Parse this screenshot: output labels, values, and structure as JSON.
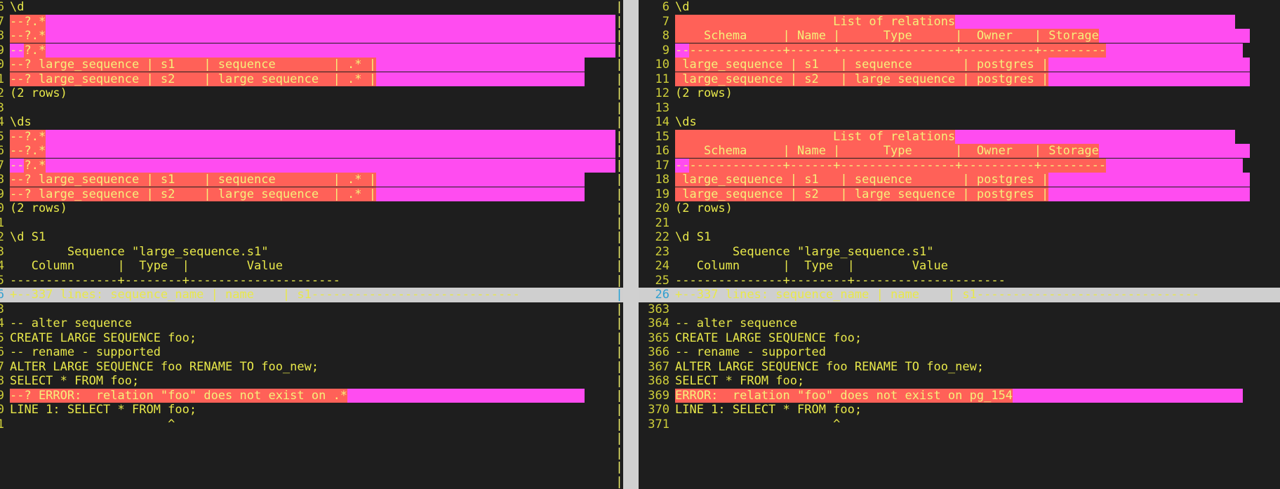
{
  "app": {
    "kind": "vimdiff-terminal",
    "colors": {
      "background": "#1e1e1e",
      "foreground": "#e8e84a",
      "line_number": "#cfcf3a",
      "diff_change_bg": "#ff6158",
      "diff_text_bg": "#ff4cf0",
      "fold_bg": "#cfcfcf",
      "fold_fg": "#1c9fd4",
      "scrollbar_bg": "#d0d0d0",
      "separator_fg": "#f2f26a"
    }
  },
  "separator": {
    "glyph": "|",
    "fold_glyph": "|"
  },
  "left_pane": {
    "name": "expected-output",
    "lines": [
      {
        "num": "6",
        "style": "plain",
        "segments": [
          {
            "cls": "plain",
            "text": "\\d"
          }
        ]
      },
      {
        "num": "7",
        "style": "diff",
        "segments": [
          {
            "cls": "dchange",
            "text": "--?.*"
          },
          {
            "cls": "dtext",
            "text": "                                                                                "
          }
        ]
      },
      {
        "num": "8",
        "style": "diff",
        "segments": [
          {
            "cls": "dchange",
            "text": "--?.*"
          },
          {
            "cls": "dtext",
            "text": "                                                                                "
          }
        ]
      },
      {
        "num": "9",
        "style": "diff",
        "segments": [
          {
            "cls": "dtext",
            "text": "--"
          },
          {
            "cls": "dchange",
            "text": "?.*"
          },
          {
            "cls": "dtext",
            "text": "                                                                                "
          }
        ]
      },
      {
        "num": "0",
        "style": "diff",
        "segments": [
          {
            "cls": "dchange",
            "text": "--? large_sequence | s1    | sequence        | .* |"
          },
          {
            "cls": "dtext",
            "text": "                             "
          }
        ]
      },
      {
        "num": "1",
        "style": "diff",
        "segments": [
          {
            "cls": "dchange",
            "text": "--? large_sequence | s2    | large sequence  | .* |"
          },
          {
            "cls": "dtext",
            "text": "                             "
          }
        ]
      },
      {
        "num": "2",
        "style": "plain",
        "segments": [
          {
            "cls": "plain",
            "text": "(2 rows)"
          }
        ]
      },
      {
        "num": "3",
        "style": "plain",
        "segments": [
          {
            "cls": "plain",
            "text": ""
          }
        ]
      },
      {
        "num": "4",
        "style": "plain",
        "segments": [
          {
            "cls": "plain",
            "text": "\\ds"
          }
        ]
      },
      {
        "num": "5",
        "style": "diff",
        "segments": [
          {
            "cls": "dchange",
            "text": "--?.*"
          },
          {
            "cls": "dtext",
            "text": "                                                                                "
          }
        ]
      },
      {
        "num": "6",
        "style": "diff",
        "segments": [
          {
            "cls": "dchange",
            "text": "--?.*"
          },
          {
            "cls": "dtext",
            "text": "                                                                                "
          }
        ]
      },
      {
        "num": "7",
        "style": "diff",
        "segments": [
          {
            "cls": "dtext",
            "text": "--"
          },
          {
            "cls": "dchange",
            "text": "?.*"
          },
          {
            "cls": "dtext",
            "text": "                                                                                "
          }
        ]
      },
      {
        "num": "8",
        "style": "diff",
        "segments": [
          {
            "cls": "dchange",
            "text": "--? large_sequence | s1    | sequence        | .* |"
          },
          {
            "cls": "dtext",
            "text": "                             "
          }
        ]
      },
      {
        "num": "9",
        "style": "diff",
        "segments": [
          {
            "cls": "dchange",
            "text": "--? large_sequence | s2    | large sequence  | .* |"
          },
          {
            "cls": "dtext",
            "text": "                             "
          }
        ]
      },
      {
        "num": "0",
        "style": "plain",
        "segments": [
          {
            "cls": "plain",
            "text": "(2 rows)"
          }
        ]
      },
      {
        "num": "1",
        "style": "plain",
        "segments": [
          {
            "cls": "plain",
            "text": ""
          }
        ]
      },
      {
        "num": "2",
        "style": "plain",
        "segments": [
          {
            "cls": "plain",
            "text": "\\d S1"
          }
        ]
      },
      {
        "num": "3",
        "style": "plain",
        "segments": [
          {
            "cls": "plain",
            "text": "        Sequence \"large_sequence.s1\""
          }
        ]
      },
      {
        "num": "4",
        "style": "plain",
        "segments": [
          {
            "cls": "plain",
            "text": "   Column      |  Type  |        Value"
          }
        ]
      },
      {
        "num": "5",
        "style": "plain",
        "segments": [
          {
            "cls": "plain",
            "text": "---------------+--------+---------------------"
          }
        ]
      },
      {
        "num": "6",
        "style": "fold",
        "segments": [
          {
            "cls": "plain",
            "text": "+--337 lines: sequence_name | name    | s1-----------------------------"
          }
        ]
      },
      {
        "num": "3",
        "style": "plain",
        "segments": [
          {
            "cls": "plain",
            "text": ""
          }
        ]
      },
      {
        "num": "4",
        "style": "plain",
        "segments": [
          {
            "cls": "plain",
            "text": "-- alter sequence"
          }
        ]
      },
      {
        "num": "5",
        "style": "plain",
        "segments": [
          {
            "cls": "plain",
            "text": "CREATE LARGE SEQUENCE foo;"
          }
        ]
      },
      {
        "num": "6",
        "style": "plain",
        "segments": [
          {
            "cls": "plain",
            "text": "-- rename - supported"
          }
        ]
      },
      {
        "num": "7",
        "style": "plain",
        "segments": [
          {
            "cls": "plain",
            "text": "ALTER LARGE SEQUENCE foo RENAME TO foo_new;"
          }
        ]
      },
      {
        "num": "8",
        "style": "plain",
        "segments": [
          {
            "cls": "plain",
            "text": "SELECT * FROM foo;"
          }
        ]
      },
      {
        "num": "9",
        "style": "diff",
        "segments": [
          {
            "cls": "dchange",
            "text": "--? ERROR:  relation \"foo\" does not exist on .*"
          },
          {
            "cls": "dtext",
            "text": "                                 "
          }
        ]
      },
      {
        "num": "0",
        "style": "plain",
        "segments": [
          {
            "cls": "plain",
            "text": "LINE 1: SELECT * FROM foo;"
          }
        ]
      },
      {
        "num": "1",
        "style": "plain",
        "segments": [
          {
            "cls": "plain",
            "text": "                      ^"
          }
        ]
      }
    ]
  },
  "right_pane": {
    "name": "actual-output",
    "lines": [
      {
        "num": "6",
        "style": "plain",
        "segments": [
          {
            "cls": "plain",
            "text": "\\d"
          }
        ]
      },
      {
        "num": "7",
        "style": "diff",
        "segments": [
          {
            "cls": "dchange",
            "text": "                      List of relations"
          },
          {
            "cls": "dtext",
            "text": "                                       "
          }
        ]
      },
      {
        "num": "8",
        "style": "diff",
        "segments": [
          {
            "cls": "dchange",
            "text": "    Schema     | Name |      Type      |  Owner   | Storage"
          },
          {
            "cls": "dtext",
            "text": "                     "
          }
        ]
      },
      {
        "num": "9",
        "style": "diff",
        "segments": [
          {
            "cls": "dtext",
            "text": "--"
          },
          {
            "cls": "dchange",
            "text": "-------------+------+----------------+----------+---------"
          },
          {
            "cls": "dtext",
            "text": "                   "
          }
        ]
      },
      {
        "num": "10",
        "style": "diff",
        "segments": [
          {
            "cls": "dchange",
            "text": " large_sequence | s1   | sequence       | postgres |"
          },
          {
            "cls": "dtext",
            "text": "                            "
          }
        ]
      },
      {
        "num": "11",
        "style": "diff",
        "segments": [
          {
            "cls": "dchange",
            "text": " large_sequence | s2   | large sequence | postgres |"
          },
          {
            "cls": "dtext",
            "text": "                            "
          }
        ]
      },
      {
        "num": "12",
        "style": "plain",
        "segments": [
          {
            "cls": "plain",
            "text": "(2 rows)"
          }
        ]
      },
      {
        "num": "13",
        "style": "plain",
        "segments": [
          {
            "cls": "plain",
            "text": ""
          }
        ]
      },
      {
        "num": "14",
        "style": "plain",
        "segments": [
          {
            "cls": "plain",
            "text": "\\ds"
          }
        ]
      },
      {
        "num": "15",
        "style": "diff",
        "segments": [
          {
            "cls": "dchange",
            "text": "                      List of relations"
          },
          {
            "cls": "dtext",
            "text": "                                       "
          }
        ]
      },
      {
        "num": "16",
        "style": "diff",
        "segments": [
          {
            "cls": "dchange",
            "text": "    Schema     | Name |      Type      |  Owner   | Storage"
          },
          {
            "cls": "dtext",
            "text": "                     "
          }
        ]
      },
      {
        "num": "17",
        "style": "diff",
        "segments": [
          {
            "cls": "dtext",
            "text": "--"
          },
          {
            "cls": "dchange",
            "text": "-------------+------+----------------+----------+---------"
          },
          {
            "cls": "dtext",
            "text": "                   "
          }
        ]
      },
      {
        "num": "18",
        "style": "diff",
        "segments": [
          {
            "cls": "dchange",
            "text": " large_sequence | s1   | sequence       | postgres |"
          },
          {
            "cls": "dtext",
            "text": "                            "
          }
        ]
      },
      {
        "num": "19",
        "style": "diff",
        "segments": [
          {
            "cls": "dchange",
            "text": " large_sequence | s2   | large sequence | postgres |"
          },
          {
            "cls": "dtext",
            "text": "                            "
          }
        ]
      },
      {
        "num": "20",
        "style": "plain",
        "segments": [
          {
            "cls": "plain",
            "text": "(2 rows)"
          }
        ]
      },
      {
        "num": "21",
        "style": "plain",
        "segments": [
          {
            "cls": "plain",
            "text": ""
          }
        ]
      },
      {
        "num": "22",
        "style": "plain",
        "segments": [
          {
            "cls": "plain",
            "text": "\\d S1"
          }
        ]
      },
      {
        "num": "23",
        "style": "plain",
        "segments": [
          {
            "cls": "plain",
            "text": "        Sequence \"large_sequence.s1\""
          }
        ]
      },
      {
        "num": "24",
        "style": "plain",
        "segments": [
          {
            "cls": "plain",
            "text": "   Column      |  Type  |        Value"
          }
        ]
      },
      {
        "num": "25",
        "style": "plain",
        "segments": [
          {
            "cls": "plain",
            "text": "---------------+--------+---------------------"
          }
        ]
      },
      {
        "num": "26",
        "style": "fold",
        "segments": [
          {
            "cls": "plain",
            "text": "+--337 lines: sequence_name | name    | s1-------------------------------"
          }
        ]
      },
      {
        "num": "363",
        "style": "plain",
        "segments": [
          {
            "cls": "plain",
            "text": ""
          }
        ]
      },
      {
        "num": "364",
        "style": "plain",
        "segments": [
          {
            "cls": "plain",
            "text": "-- alter sequence"
          }
        ]
      },
      {
        "num": "365",
        "style": "plain",
        "segments": [
          {
            "cls": "plain",
            "text": "CREATE LARGE SEQUENCE foo;"
          }
        ]
      },
      {
        "num": "366",
        "style": "plain",
        "segments": [
          {
            "cls": "plain",
            "text": "-- rename - supported"
          }
        ]
      },
      {
        "num": "367",
        "style": "plain",
        "segments": [
          {
            "cls": "plain",
            "text": "ALTER LARGE SEQUENCE foo RENAME TO foo_new;"
          }
        ]
      },
      {
        "num": "368",
        "style": "plain",
        "segments": [
          {
            "cls": "plain",
            "text": "SELECT * FROM foo;"
          }
        ]
      },
      {
        "num": "369",
        "style": "diff",
        "segments": [
          {
            "cls": "dchange",
            "text": "ERROR:  relation \"foo\" does not exist on pg_154"
          },
          {
            "cls": "dtext",
            "text": "                                "
          }
        ]
      },
      {
        "num": "370",
        "style": "plain",
        "segments": [
          {
            "cls": "plain",
            "text": "LINE 1: SELECT * FROM foo;"
          }
        ]
      },
      {
        "num": "371",
        "style": "plain",
        "segments": [
          {
            "cls": "plain",
            "text": "                      ^"
          }
        ]
      }
    ]
  }
}
